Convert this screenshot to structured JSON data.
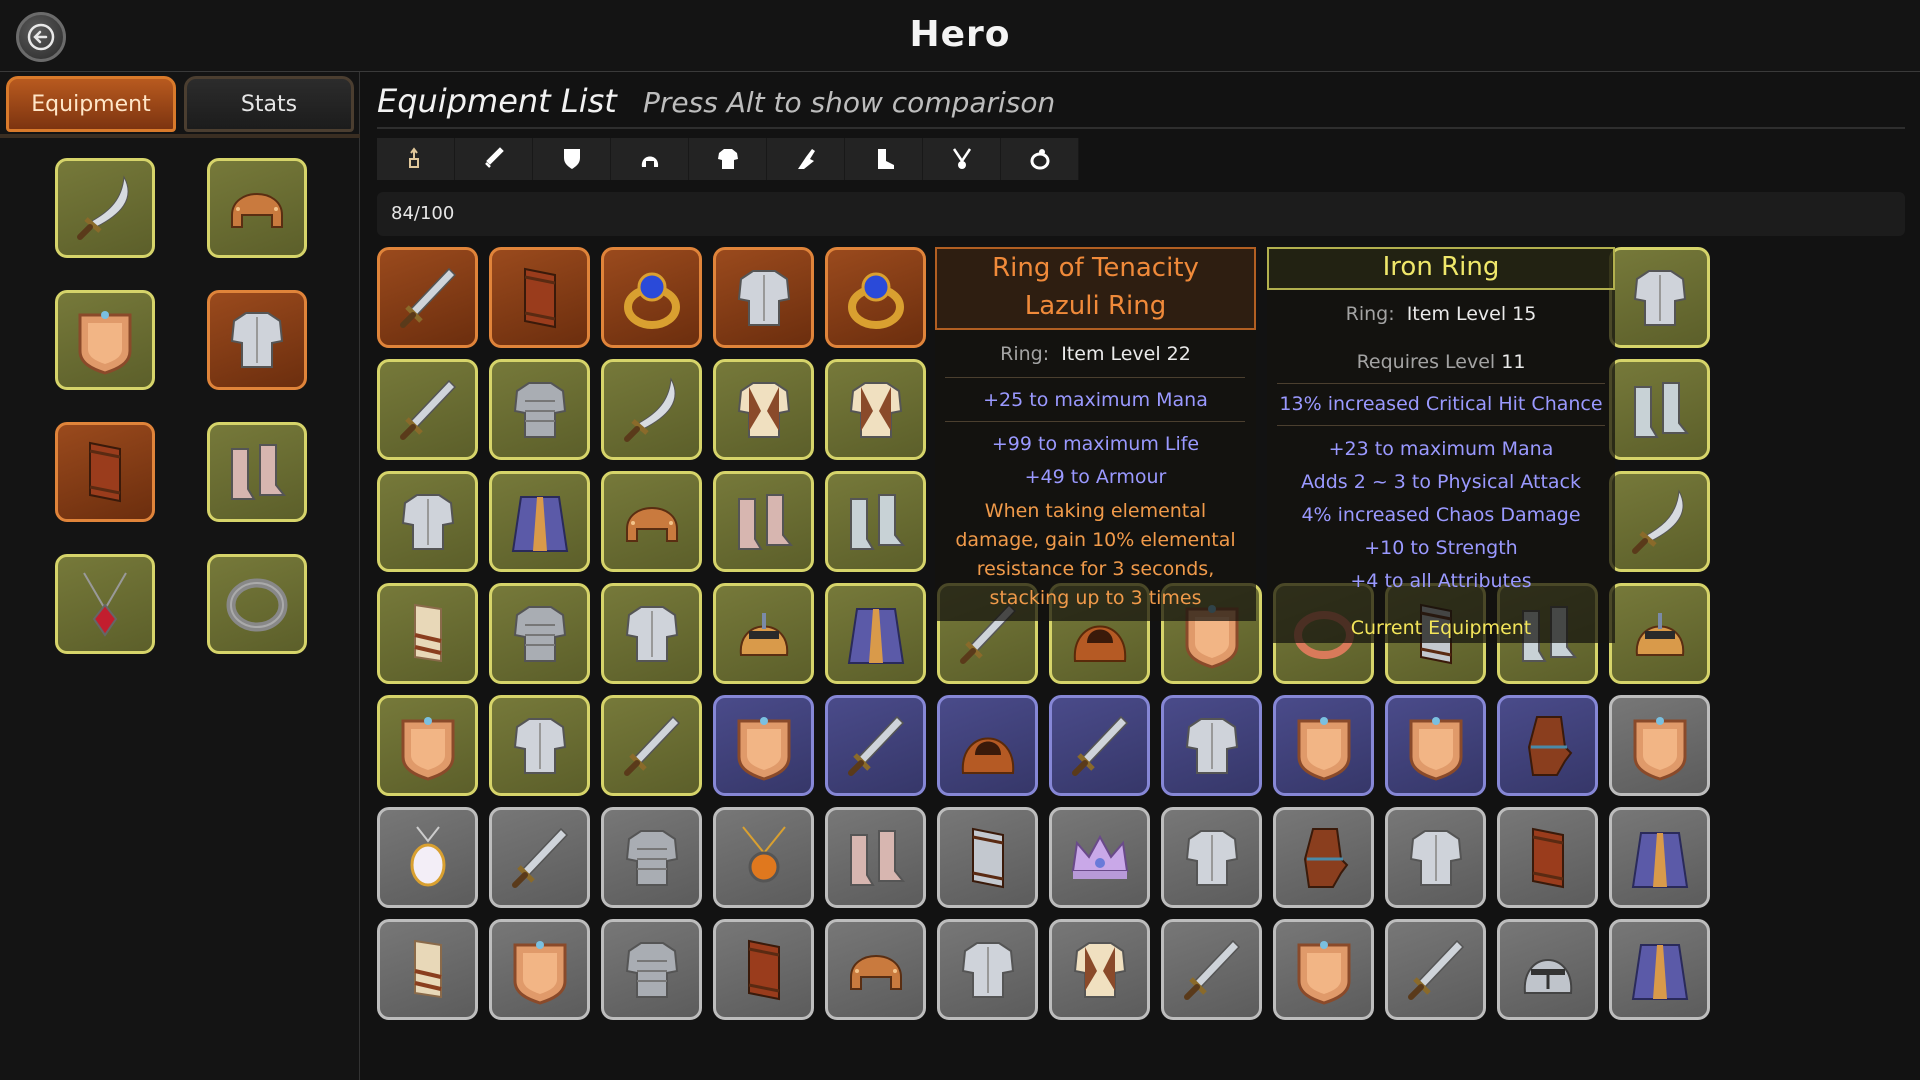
{
  "header": {
    "title": "Hero",
    "back_icon": "back-arrow-icon"
  },
  "tabs": [
    {
      "label": "Equipment",
      "active": true
    },
    {
      "label": "Stats",
      "active": false
    }
  ],
  "equipped": [
    {
      "icon": "scimitar-icon",
      "rarity": "yellow"
    },
    {
      "icon": "bronze-helmet-icon",
      "rarity": "yellow"
    },
    {
      "icon": "bronze-shield-icon",
      "rarity": "yellow"
    },
    {
      "icon": "steel-chest-armor-icon",
      "rarity": "orange"
    },
    {
      "icon": "leather-bracer-icon",
      "rarity": "orange"
    },
    {
      "icon": "leather-boots-icon",
      "rarity": "yellow"
    },
    {
      "icon": "ruby-amulet-icon",
      "rarity": "yellow"
    },
    {
      "icon": "iron-ring-icon",
      "rarity": "yellow"
    }
  ],
  "equipment_list": {
    "title": "Equipment List",
    "hint": "Press Alt to show comparison",
    "count": "84/100",
    "filters": [
      "all-icon",
      "weapon-icon",
      "shield-icon",
      "helmet-icon",
      "chest-armor-icon",
      "gloves-icon",
      "boots-icon",
      "amulet-icon",
      "ring-icon"
    ]
  },
  "grid": [
    [
      "sword|orange",
      "bracer|orange",
      "sapphire-ring|orange",
      "steel-chest|orange",
      "sapphire-ring|orange",
      "",
      "",
      "",
      "",
      "",
      "",
      "steel-chest|yellow"
    ],
    [
      "sword|yellow",
      "chainmail-tunic|yellow",
      "scimitar|yellow",
      "leather-vest|yellow",
      "leather-vest|yellow",
      "",
      "",
      "",
      "",
      "",
      "",
      "steel-boots|yellow"
    ],
    [
      "steel-chest|yellow",
      "mage-robe|yellow",
      "bronze-helmet|yellow",
      "leather-boots|yellow",
      "steel-boots|yellow",
      "",
      "",
      "",
      "",
      "",
      "",
      "scimitar|yellow"
    ],
    [
      "bandage-wrap|yellow",
      "chainmail-tunic|yellow",
      "leather-chest|yellow",
      "golden-helm|yellow",
      "mage-robe|yellow",
      "sword|yellow",
      "hood|yellow",
      "bronze-shield|yellow",
      "copper-ring|yellow",
      "steel-bracer|yellow",
      "steel-boots|yellow",
      "golden-helm|yellow"
    ],
    [
      "bronze-shield|yellow",
      "leather-chest|yellow",
      "sword|yellow",
      "bronze-shield|blue",
      "sword|blue",
      "hood|blue",
      "sword|blue",
      "steel-chest|blue",
      "bronze-shield|blue",
      "bronze-shield|blue",
      "leather-glove|blue",
      "bronze-shield|gray"
    ],
    [
      "pearl-amulet|gray",
      "sword|gray",
      "chainmail-tunic|gray",
      "amber-amulet|gray",
      "leather-boots|gray",
      "steel-bracer|gray",
      "crown|gray",
      "leather-chest|gray",
      "leather-glove|gray",
      "leather-chest|gray",
      "bracer|gray",
      "mage-robe|gray"
    ],
    [
      "bandage-wrap|gray",
      "bronze-shield|gray",
      "chainmail-tunic|gray",
      "bracer|gray",
      "bronze-helmet|gray",
      "chain-chest|gray",
      "leather-vest|gray",
      "sword|gray",
      "bronze-shield|gray",
      "sword|gray",
      "knight-helm|gray",
      "mage-robe|gray"
    ]
  ],
  "tooltip_left": {
    "title_1": "Ring of Tenacity",
    "title_2": "Lazuli Ring",
    "type_label": "Ring:",
    "item_level": "Item Level 22",
    "mods": [
      "+25 to maximum Mana",
      "+99 to maximum Life",
      "+49 to Armour"
    ],
    "special": [
      "When taking elemental",
      "damage, gain 10% elemental",
      "resistance for 3 seconds,",
      "stacking up to 3 times"
    ]
  },
  "tooltip_right": {
    "title": "Iron Ring",
    "type_label": "Ring:",
    "item_level": "Item Level 15",
    "requires_label": "Requires Level",
    "requires_value": "11",
    "mods": [
      "13% increased Critical Hit Chance",
      "+23 to maximum Mana",
      "Adds 2 ~ 3 to Physical Attack",
      "4% increased Chaos Damage",
      "+10 to Strength",
      "+4 to all Attributes"
    ],
    "footer": "Current Equipment"
  },
  "colors": {
    "orange": "#e0843a",
    "yellow": "#d6d46a",
    "blue": "#8687d6",
    "gray": "#bdbdbd",
    "mod_text": "#9a99ff"
  }
}
